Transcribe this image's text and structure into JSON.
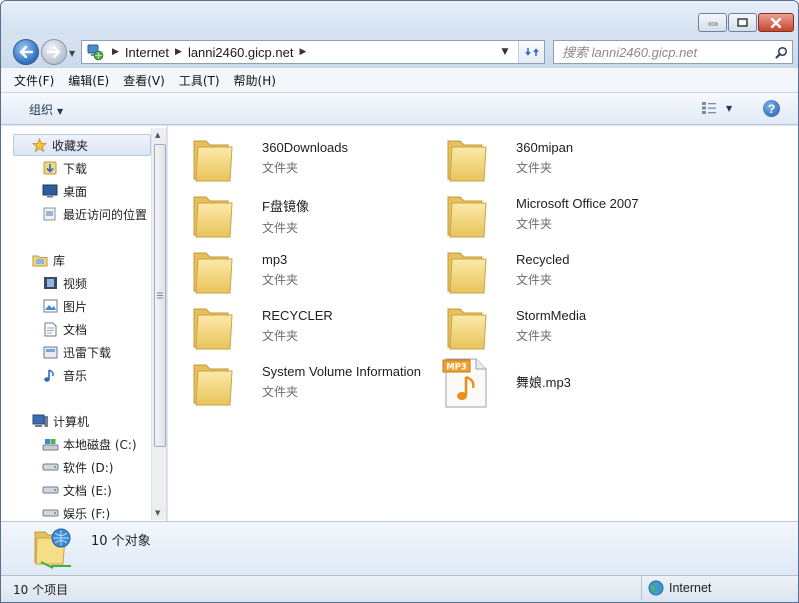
{
  "address": {
    "crumbs": [
      "Internet",
      "lanni2460.gicp.net"
    ]
  },
  "search": {
    "placeholder": "搜索 lanni2460.gicp.net"
  },
  "menu": {
    "items": [
      "文件(F)",
      "编辑(E)",
      "查看(V)",
      "工具(T)",
      "帮助(H)"
    ]
  },
  "toolbar": {
    "organize_label": "组织"
  },
  "nav": {
    "favorites_header": "收藏夹",
    "favorites": [
      "下载",
      "桌面",
      "最近访问的位置"
    ],
    "libraries_header": "库",
    "libraries": [
      "视频",
      "图片",
      "文档",
      "迅雷下载",
      "音乐"
    ],
    "computer_header": "计算机",
    "drives": [
      "本地磁盘 (C:)",
      "软件 (D:)",
      "文档 (E:)",
      "娱乐 (F:)"
    ]
  },
  "files": [
    {
      "name": "360Downloads",
      "type": "文件夹",
      "icon": "folder-icon"
    },
    {
      "name": "360mipan",
      "type": "文件夹",
      "icon": "folder-icon"
    },
    {
      "name": "F盘镜像",
      "type": "文件夹",
      "icon": "folder-icon"
    },
    {
      "name": "Microsoft Office 2007",
      "type": "文件夹",
      "icon": "folder-icon"
    },
    {
      "name": "mp3",
      "type": "文件夹",
      "icon": "folder-icon"
    },
    {
      "name": "Recycled",
      "type": "文件夹",
      "icon": "folder-icon"
    },
    {
      "name": "RECYCLER",
      "type": "文件夹",
      "icon": "folder-icon"
    },
    {
      "name": "StormMedia",
      "type": "文件夹",
      "icon": "folder-icon"
    },
    {
      "name": "System Volume Information",
      "type": "文件夹",
      "icon": "folder-icon"
    },
    {
      "name": "舞娘.mp3",
      "type": "",
      "icon": "mp3-file-icon",
      "badge": "MP3"
    }
  ],
  "details": {
    "summary": "10 个对象"
  },
  "status": {
    "count": "10 个项目",
    "zone": "Internet"
  },
  "colors": {
    "folder": "#f3d77a",
    "accent": "#1e395b",
    "close": "#c8442c"
  }
}
